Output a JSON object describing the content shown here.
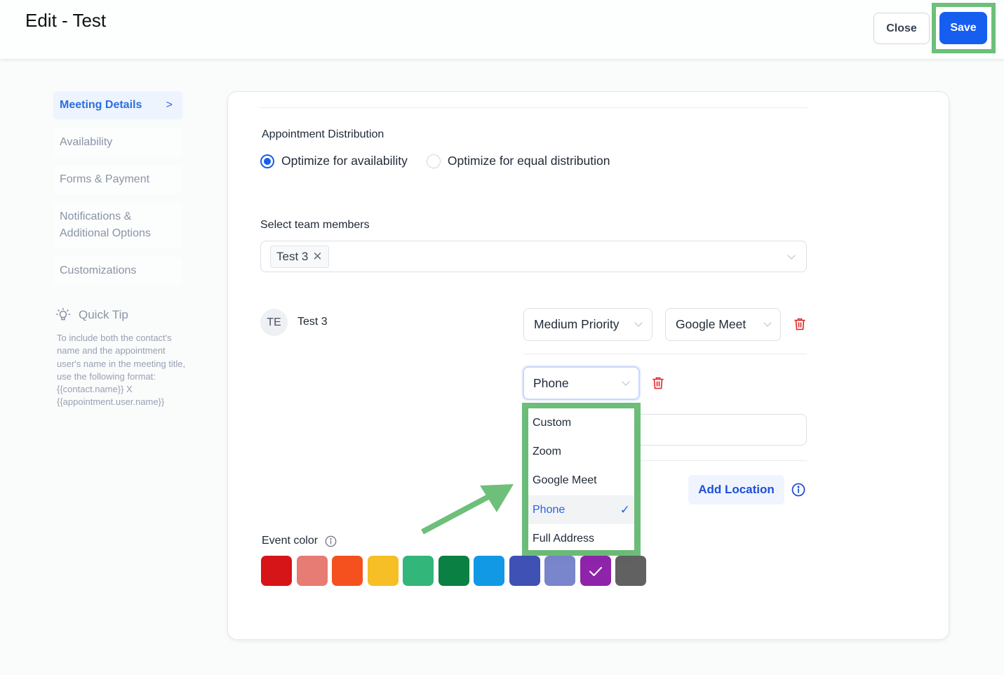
{
  "header": {
    "title": "Edit - Test",
    "close_label": "Close",
    "save_label": "Save"
  },
  "sidebar": {
    "items": [
      {
        "label": "Meeting Details",
        "active": true
      },
      {
        "label": "Availability",
        "active": false
      },
      {
        "label": "Forms & Payment",
        "active": false
      },
      {
        "label": "Notifications & Additional Options",
        "active": false
      },
      {
        "label": "Customizations",
        "active": false
      }
    ],
    "chevron_glyph": ">"
  },
  "quick_tip": {
    "title": "Quick Tip",
    "body": "To include both the contact's name and the appointment user's name in the meeting title, use the following format: {{contact.name}} X {{appointment.user.name}}"
  },
  "form": {
    "distribution": {
      "label": "Appointment Distribution",
      "options": [
        {
          "label": "Optimize for availability",
          "checked": true
        },
        {
          "label": "Optimize for equal distribution",
          "checked": false
        }
      ]
    },
    "team_members": {
      "label": "Select team members",
      "selected_tags": [
        "Test 3"
      ],
      "remove_glyph": "✕"
    },
    "member": {
      "initials": "TE",
      "name": "Test 3",
      "priority": "Medium Priority",
      "location_primary": "Google Meet",
      "location_secondary": "Phone"
    },
    "location_dropdown": {
      "options": [
        {
          "label": "Custom",
          "selected": false
        },
        {
          "label": "Zoom",
          "selected": false
        },
        {
          "label": "Google Meet",
          "selected": false
        },
        {
          "label": "Phone",
          "selected": true
        },
        {
          "label": "Full Address",
          "selected": false
        }
      ],
      "check_glyph": "✓"
    },
    "add_location_label": "Add Location",
    "event_color": {
      "label": "Event color",
      "swatches": [
        {
          "color": "#d61518",
          "selected": false
        },
        {
          "color": "#e67c73",
          "selected": false
        },
        {
          "color": "#f4511e",
          "selected": false
        },
        {
          "color": "#f6bf26",
          "selected": false
        },
        {
          "color": "#33b679",
          "selected": false
        },
        {
          "color": "#0b8043",
          "selected": false
        },
        {
          "color": "#1199e6",
          "selected": false
        },
        {
          "color": "#3f51b5",
          "selected": false
        },
        {
          "color": "#7986cb",
          "selected": false
        },
        {
          "color": "#8e24aa",
          "selected": true
        },
        {
          "color": "#616161",
          "selected": false
        }
      ]
    }
  },
  "colors": {
    "accent": "#155eef",
    "highlight": "#6dbf7a",
    "danger": "#e02424"
  }
}
